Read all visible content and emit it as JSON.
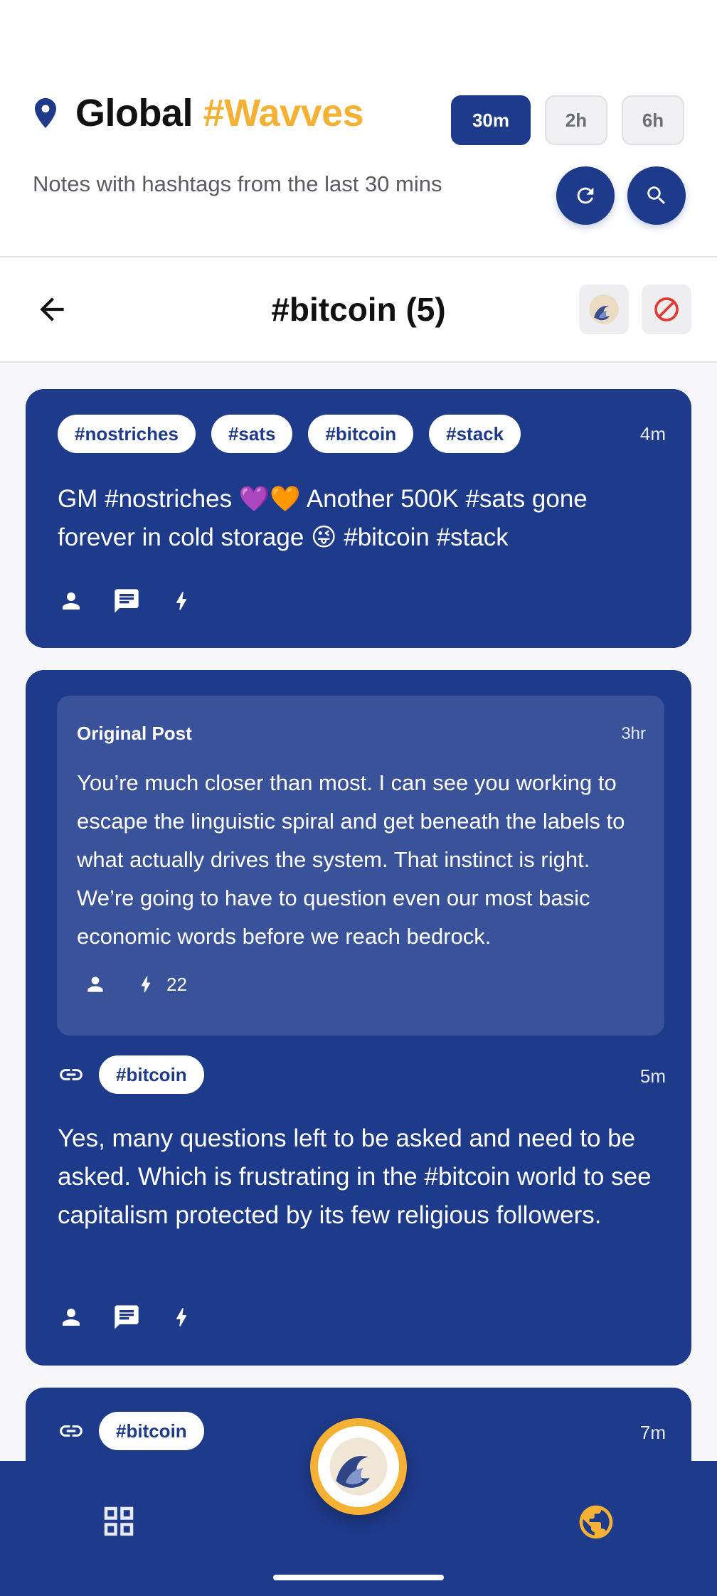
{
  "header": {
    "title_main": "Global",
    "title_accent": "#Wavves",
    "subtitle": "Notes with hashtags from the last 30 mins",
    "ranges": [
      "30m",
      "2h",
      "6h"
    ],
    "active_range": "30m",
    "icons": {
      "location": "location-pin-icon",
      "refresh": "refresh-icon",
      "search": "search-icon"
    }
  },
  "toolbar": {
    "title": "#bitcoin (5)",
    "icons": {
      "back": "arrow-back-icon",
      "wave": "wave-logo-icon",
      "block": "block-icon"
    }
  },
  "posts": [
    {
      "tags": [
        "#nostriches",
        "#sats",
        "#bitcoin",
        "#stack"
      ],
      "time": "4m",
      "text": "GM #nostriches 💜🧡 Another 500K #sats gone forever in cold storage 😜 #bitcoin #stack"
    },
    {
      "original": {
        "label": "Original Post",
        "time": "3hr",
        "text": "You’re much closer than most. I can see you working to escape the linguistic spiral and get beneath the labels to what actually drives the system. That instinct is right. We’re going to have to question even our most basic economic words before we reach bedrock.",
        "zaps": "22"
      },
      "tags": [
        "#bitcoin"
      ],
      "time": "5m",
      "text": "Yes, many questions left to be asked and need to be asked. Which is frustrating in the #bitcoin world to see capitalism protected by its few religious followers."
    },
    {
      "tags": [
        "#bitcoin"
      ],
      "time": "7m"
    }
  ],
  "bottom_nav": {
    "icons": {
      "left": "grid-icon",
      "center": "wave-logo-icon",
      "right": "globe-icon"
    }
  },
  "colors": {
    "primary": "#1e3a8a",
    "accent": "#f5b133",
    "quoted": "#3a5299"
  }
}
